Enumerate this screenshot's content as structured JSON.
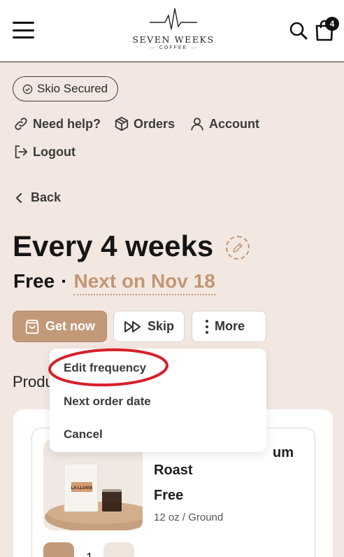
{
  "header": {
    "menu_icon": "hamburger-menu-icon",
    "logo_name": "SEVEN WEEKS",
    "logo_sub": "COFFEE",
    "search_icon": "search-icon",
    "cart_icon": "shopping-bag-icon",
    "cart_count": "4"
  },
  "secure_badge": {
    "label": "Skio Secured",
    "icon": "check-circle-icon"
  },
  "nav": {
    "help": {
      "label": "Need help?",
      "icon": "link-icon"
    },
    "orders": {
      "label": "Orders",
      "icon": "box-icon"
    },
    "account": {
      "label": "Account",
      "icon": "user-icon"
    },
    "logout": {
      "label": "Logout",
      "icon": "logout-icon"
    }
  },
  "back": {
    "label": "Back",
    "icon": "chevron-left-icon"
  },
  "subscription": {
    "title": "Every 4 weeks",
    "edit_icon": "pencil-icon",
    "price": "Free",
    "separator": "·",
    "next_order": "Next on Nov 18"
  },
  "actions": {
    "get_now": {
      "label": "Get now",
      "icon": "bag-icon"
    },
    "skip": {
      "label": "Skip",
      "icon": "fast-forward-icon"
    },
    "more": {
      "label": "More",
      "icon": "more-vertical-icon"
    }
  },
  "dropdown": {
    "items": [
      "Edit frequency",
      "Next order date",
      "Cancel"
    ],
    "highlighted": "Edit frequency"
  },
  "products": {
    "heading": "Products",
    "items": [
      {
        "name_line1": "um",
        "name_line2": "Roast",
        "price": "Free",
        "variant": "12 oz / Ground",
        "quantity": "1",
        "bag_label": "LA LLUVIA"
      }
    ]
  },
  "colors": {
    "background": "#f3e8e1",
    "accent": "#c29a79",
    "highlight": "#d6202a",
    "text": "#1f2023"
  }
}
